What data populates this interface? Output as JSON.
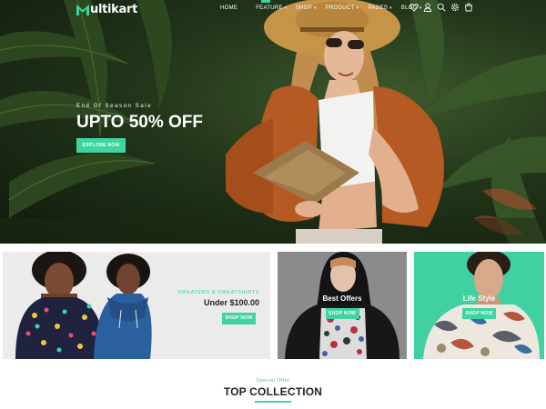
{
  "header": {
    "logo_letter": "M",
    "logo_text": "ultikart",
    "menu": [
      {
        "label": "Home",
        "caret": ""
      },
      {
        "label": "Feature",
        "caret": "▾"
      },
      {
        "label": "Shop",
        "caret": "▾"
      },
      {
        "label": "Product",
        "caret": "▾"
      },
      {
        "label": "Pages",
        "caret": "▾"
      },
      {
        "label": "Blog",
        "caret": "▾"
      }
    ],
    "icons": [
      "heart-icon",
      "user-icon",
      "search-icon",
      "settings-icon",
      "cart-icon"
    ]
  },
  "hero": {
    "subtitle": "End Of Season Sale",
    "title": "UPTO 50% OFF",
    "button_label": "Explore Now"
  },
  "banners": [
    {
      "subtitle": "SWEATERS & SWEATSHIRTS",
      "title": "Under $100.00",
      "button_label": "Shop Now"
    },
    {
      "title": "Best Offers",
      "button_label": "Shop Now"
    },
    {
      "title": "Life Style",
      "button_label": "Shop Now"
    }
  ],
  "section": {
    "subtitle": "Special Offer",
    "title": "TOP COLLECTION"
  },
  "colors": {
    "accent": "#3fd4a1",
    "heading": "#222222",
    "banner_gray": "#ebebeb",
    "banner_mid": "#8b8b8e",
    "banner_green": "#40d0a2"
  }
}
